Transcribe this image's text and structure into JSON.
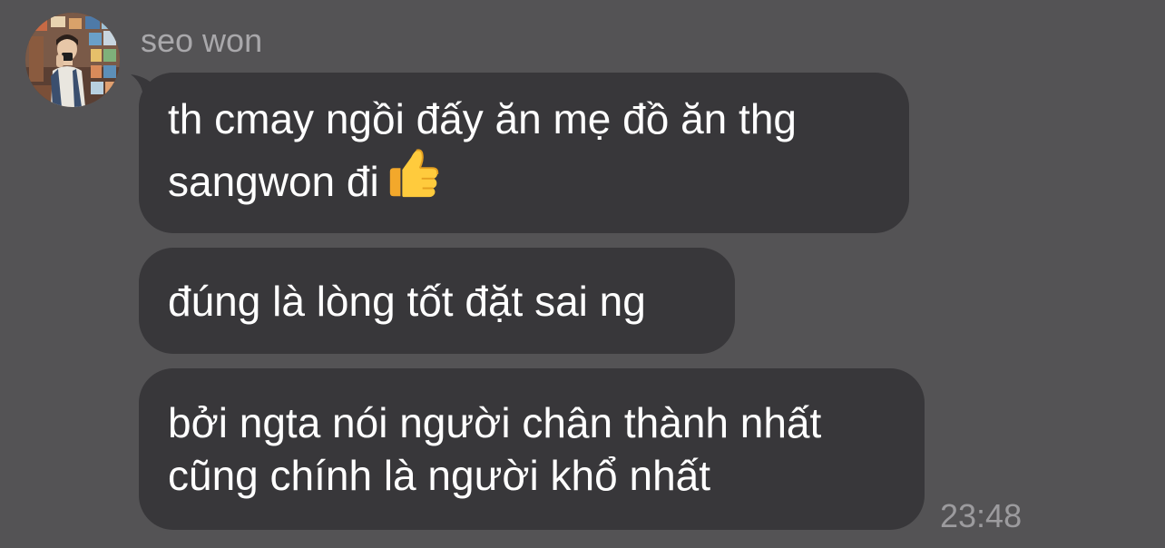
{
  "chat": {
    "sender": {
      "name": "seo won",
      "avatar": "profile-photo"
    },
    "messages": [
      {
        "lines": [
          "th cmay ngồi đấy ăn mẹ đồ ăn thg",
          "sangwon đi"
        ],
        "emoji": "thumbs-up-icon"
      },
      {
        "lines": [
          "đúng là lòng tốt đặt sai ng"
        ]
      },
      {
        "lines": [
          "bởi ngta nói người chân thành nhất",
          "cũng chính là người khổ nhất"
        ]
      }
    ],
    "timestamp": "23:48"
  },
  "colors": {
    "background": "#545355",
    "bubble": "#38373a",
    "text": "#ffffff",
    "sender_name": "#a9a8ab",
    "timestamp": "#9c9b9e"
  }
}
